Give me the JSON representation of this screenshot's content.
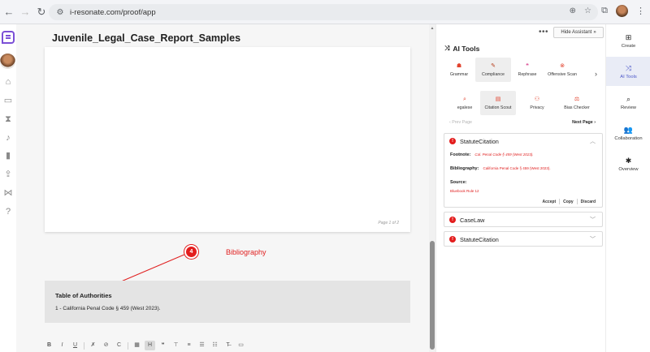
{
  "browser": {
    "url": "i-resonate.com/proof/app"
  },
  "document": {
    "title": "Juvenile_Legal_Case_Report_Samples",
    "page_number": "Page 1 of 2",
    "annotation": {
      "marker": "4",
      "label": "Bibliography"
    },
    "toa": {
      "title": "Table of Authorities",
      "item": "1 -  California Penal Code § 459 (West 2023)."
    },
    "toolbar": [
      {
        "name": "bold-button",
        "glyph": "B"
      },
      {
        "name": "italic-button",
        "glyph": "I"
      },
      {
        "name": "underline-button",
        "glyph": "U"
      },
      {
        "name": "sep"
      },
      {
        "name": "clear-format-button",
        "glyph": "✗"
      },
      {
        "name": "link-button",
        "glyph": "⊘"
      },
      {
        "name": "citation-button",
        "glyph": "C"
      },
      {
        "name": "sep"
      },
      {
        "name": "table-button",
        "glyph": "▦"
      },
      {
        "name": "heading-button",
        "glyph": "H",
        "active": true
      },
      {
        "name": "quote-button",
        "glyph": "❝"
      },
      {
        "name": "align-button",
        "glyph": "⊤"
      },
      {
        "name": "list-bullet-button",
        "glyph": "≡"
      },
      {
        "name": "list-number-button",
        "glyph": "☰"
      },
      {
        "name": "list-check-button",
        "glyph": "☷"
      },
      {
        "name": "strike-button",
        "glyph": "T̶"
      },
      {
        "name": "image-button",
        "glyph": "▭"
      }
    ]
  },
  "panel": {
    "hide_label": "Hide Assistant",
    "title": "AI Tools",
    "tools_row1": [
      {
        "label": "Grammar",
        "icon": "☗",
        "style": "",
        "w": 40
      },
      {
        "label": "Compliance",
        "icon": "✎",
        "style": "dark",
        "w": 44,
        "active": true
      },
      {
        "label": "Rephrase",
        "icon": "❝",
        "style": "pink",
        "w": 40
      },
      {
        "label": "Offensive Scan",
        "icon": "⊗",
        "style": "",
        "w": 46
      }
    ],
    "tools_row2": [
      {
        "label": "egalese",
        "icon": "⌕",
        "style": "",
        "w": 38
      },
      {
        "label": "Citation Scout",
        "icon": "▤",
        "style": "",
        "w": 44,
        "active": true
      },
      {
        "label": "Privacy",
        "icon": "⚇",
        "style": "",
        "w": 52
      },
      {
        "label": "Bias Checker",
        "icon": "⚖",
        "style": "",
        "w": 46
      }
    ],
    "prev_label": "Prev Page",
    "next_label": "Next Page",
    "cards": [
      {
        "title": "StatuteCitation",
        "footnote_label": "Footnote:",
        "footnote_value": "Cal. Penal Code § 459 (West 2023).",
        "bibliography_label": "Bibliography:",
        "bibliography_value": "California Penal Code § 459 (West 2023).",
        "source_label": "Source:",
        "source_value": "Bluebook Rule 12",
        "accept_label": "Accept",
        "copy_label": "Copy",
        "discard_label": "Discard"
      },
      {
        "title": "CaseLaw"
      },
      {
        "title": "StatuteCitation"
      }
    ]
  },
  "rnav": [
    {
      "label": "Create",
      "icon": "⊞",
      "name": "create"
    },
    {
      "label": "AI Tools",
      "icon": "⤨",
      "name": "ai-tools",
      "active": true
    },
    {
      "label": "Review",
      "icon": "⌕",
      "name": "review"
    },
    {
      "label": "Collaboration",
      "icon": "👥",
      "name": "collaboration"
    },
    {
      "label": "Overview",
      "icon": "✱",
      "name": "overview"
    }
  ]
}
